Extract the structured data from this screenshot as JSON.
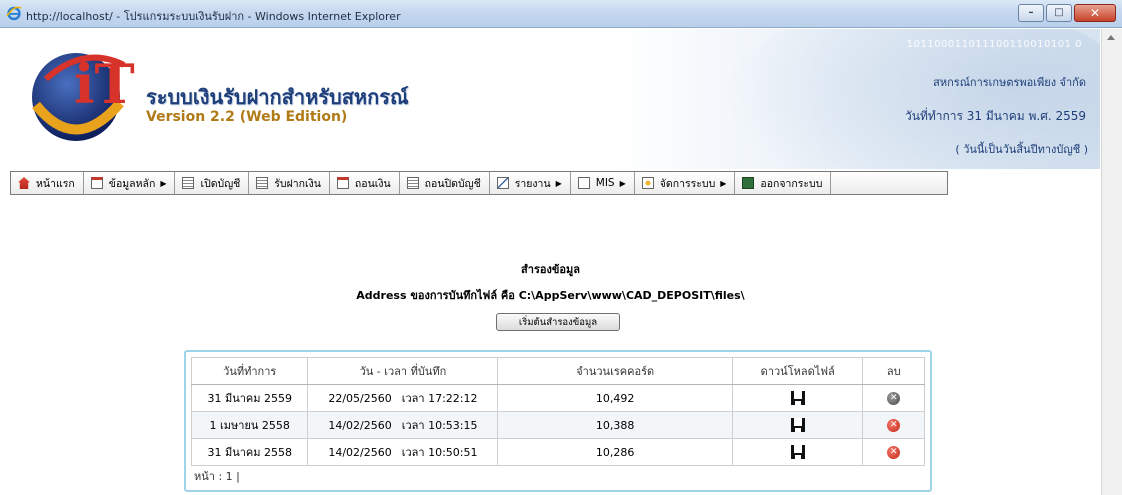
{
  "window": {
    "title": "http://localhost/ - โปรแกรมระบบเงินรับฝาก - Windows Internet Explorer",
    "minimize": "–",
    "maximize": "□",
    "close": "✕"
  },
  "header": {
    "binary_text": "101100011011100110010101 0",
    "app_title": "ระบบเงินรับฝากสำหรับสหกรณ์",
    "version": "Version 2.2 (Web Edition)",
    "coop_name": "สหกรณ์การเกษตรพอเพียง จำกัด",
    "work_date": "วันที่ทำการ 31 มีนาคม พ.ศ. 2559",
    "eod_note": "( วันนี้เป็นวันสิ้นปีทางบัญชี )",
    "logo_text": "iT"
  },
  "menu": {
    "items": [
      {
        "label": "หน้าแรก",
        "icon": "home-icon",
        "has_submenu": false
      },
      {
        "label": "ข้อมูลหลัก",
        "icon": "document-icon",
        "has_submenu": true
      },
      {
        "label": "เปิดบัญชี",
        "icon": "list-icon",
        "has_submenu": false
      },
      {
        "label": "รับฝากเงิน",
        "icon": "list-icon",
        "has_submenu": false
      },
      {
        "label": "ถอนเงิน",
        "icon": "document-icon",
        "has_submenu": false
      },
      {
        "label": "ถอนปิดบัญชี",
        "icon": "list-icon",
        "has_submenu": false
      },
      {
        "label": "รายงาน",
        "icon": "chart-icon",
        "has_submenu": true
      },
      {
        "label": "MIS",
        "icon": "document-icon",
        "has_submenu": true
      },
      {
        "label": "จัดการระบบ",
        "icon": "gear-icon",
        "has_submenu": true
      },
      {
        "label": "ออกจากระบบ",
        "icon": "exit-icon",
        "has_submenu": false
      }
    ]
  },
  "content": {
    "section_title": "สำรองข้อมูล",
    "address_line": "Address ของการบันทึกไฟล์ คือ C:\\AppServ\\www\\CAD_DEPOSIT\\files\\",
    "backup_button": "เริ่มต้นสำรองข้อมูล"
  },
  "backups": {
    "columns": [
      "วันที่ทำการ",
      "วัน - เวลา ที่บันทึก",
      "จำนวนเรคคอร์ด",
      "ดาวน์โหลดไฟล์",
      "ลบ"
    ],
    "rows": [
      {
        "work_date": "31 มีนาคม 2559",
        "saved_date": "22/05/2560",
        "saved_time": "เวลา 17:22:12",
        "records": "10,492",
        "delete_style": "gray"
      },
      {
        "work_date": "1 เมษายน 2558",
        "saved_date": "14/02/2560",
        "saved_time": "เวลา 10:53:15",
        "records": "10,388",
        "delete_style": "red"
      },
      {
        "work_date": "31 มีนาคม 2558",
        "saved_date": "14/02/2560",
        "saved_time": "เวลา 10:50:51",
        "records": "10,286",
        "delete_style": "red"
      }
    ],
    "pager": "หน้า : 1 |"
  }
}
